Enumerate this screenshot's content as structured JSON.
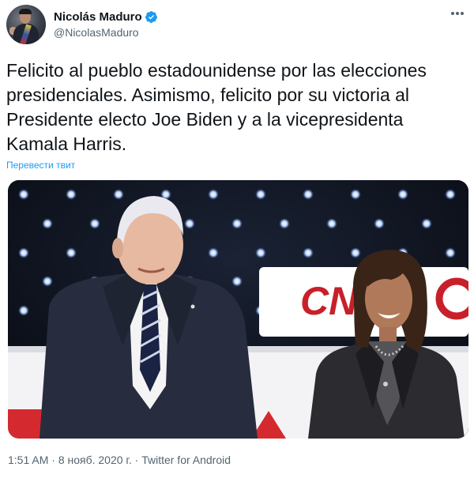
{
  "author": {
    "display_name": "Nicolás Maduro",
    "username": "@NicolasMaduro",
    "verified": true,
    "avatar_icon": "avatar-photo"
  },
  "tweet": {
    "text": "Felicito al pueblo estadounidense por las elecciones\npresidenciales. Asimismo, felicito por su victoria al\nPresidente electo Joe Biden y a la vicepresidenta\nKamala Harris.",
    "translate_label": "Перевести твит",
    "photo_sign_text": "CNN"
  },
  "meta": {
    "time": "1:51 AM",
    "date": "8 нояб. 2020 г.",
    "source": "Twitter for Android",
    "separator": " · "
  },
  "colors": {
    "link": "#1d9bf0",
    "verified": "#1d9bf0",
    "secondary_text": "#536471",
    "cnn_red": "#c8202a"
  },
  "icons": {
    "verified": "verified-badge-icon",
    "more": "more-options-icon"
  }
}
